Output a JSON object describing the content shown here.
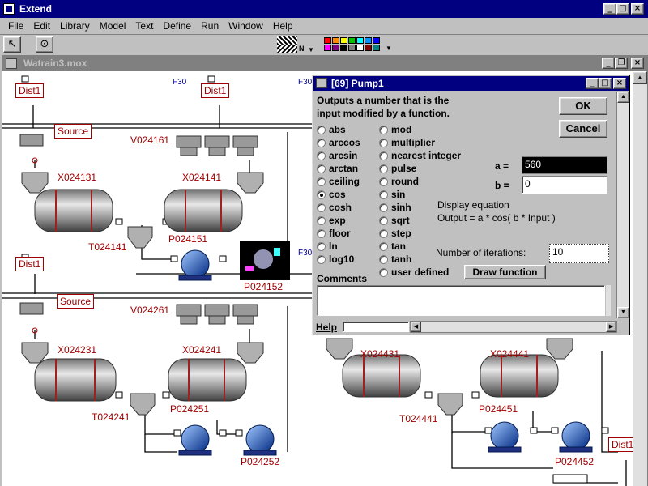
{
  "app": {
    "title": "Extend"
  },
  "menu": [
    "File",
    "Edit",
    "Library",
    "Model",
    "Text",
    "Define",
    "Run",
    "Window",
    "Help"
  ],
  "doc": {
    "title": "Watrain3.mox"
  },
  "palette": [
    "#ff0000",
    "#ff8800",
    "#ffff00",
    "#00c000",
    "#00ffff",
    "#0090ff",
    "#0000ff",
    "#ff00ff",
    "#800080",
    "#000000",
    "#808080",
    "#ffffff",
    "#800000",
    "#008080"
  ],
  "model": {
    "dist_labels": [
      "Dist1",
      "Dist1",
      "Dist1",
      "Dist1"
    ],
    "source_labels": [
      "Source",
      "Source"
    ],
    "f_labels": [
      "F30",
      "F30",
      "F30"
    ],
    "tanks": [
      "V024161",
      "V024261"
    ],
    "mixers": [
      "X024131",
      "X024141",
      "X024231",
      "X024241",
      "X024431",
      "X024441"
    ],
    "hoppers": [
      "T024141",
      "T024241",
      "T024441"
    ],
    "pumps": [
      "P024151",
      "P024152",
      "P024251",
      "P024252",
      "P024451",
      "P024452"
    ]
  },
  "dialog": {
    "title": "[69]   Pump1",
    "description_line1": "Outputs a number that is the",
    "description_line2": "input modified by a function.",
    "ok_label": "OK",
    "cancel_label": "Cancel",
    "functions_col1": [
      "abs",
      "arccos",
      "arcsin",
      "arctan",
      "ceiling",
      "cos",
      "cosh",
      "exp",
      "floor",
      "ln",
      "log10"
    ],
    "functions_col2": [
      "mod",
      "multiplier",
      "nearest integer",
      "pulse",
      "round",
      "sin",
      "sinh",
      "sqrt",
      "step",
      "tan",
      "tanh",
      "user defined"
    ],
    "selected_function": "cos",
    "a_label": "a =",
    "a_value": "560",
    "b_label": "b =",
    "b_value": "0",
    "display_equation_label": "Display equation",
    "equation": "Output = a * cos( b * Input )",
    "iterations_label": "Number of iterations:",
    "iterations_value": "10",
    "draw_function_label": "Draw function",
    "comments_label": "Comments",
    "help_label": "Help"
  }
}
